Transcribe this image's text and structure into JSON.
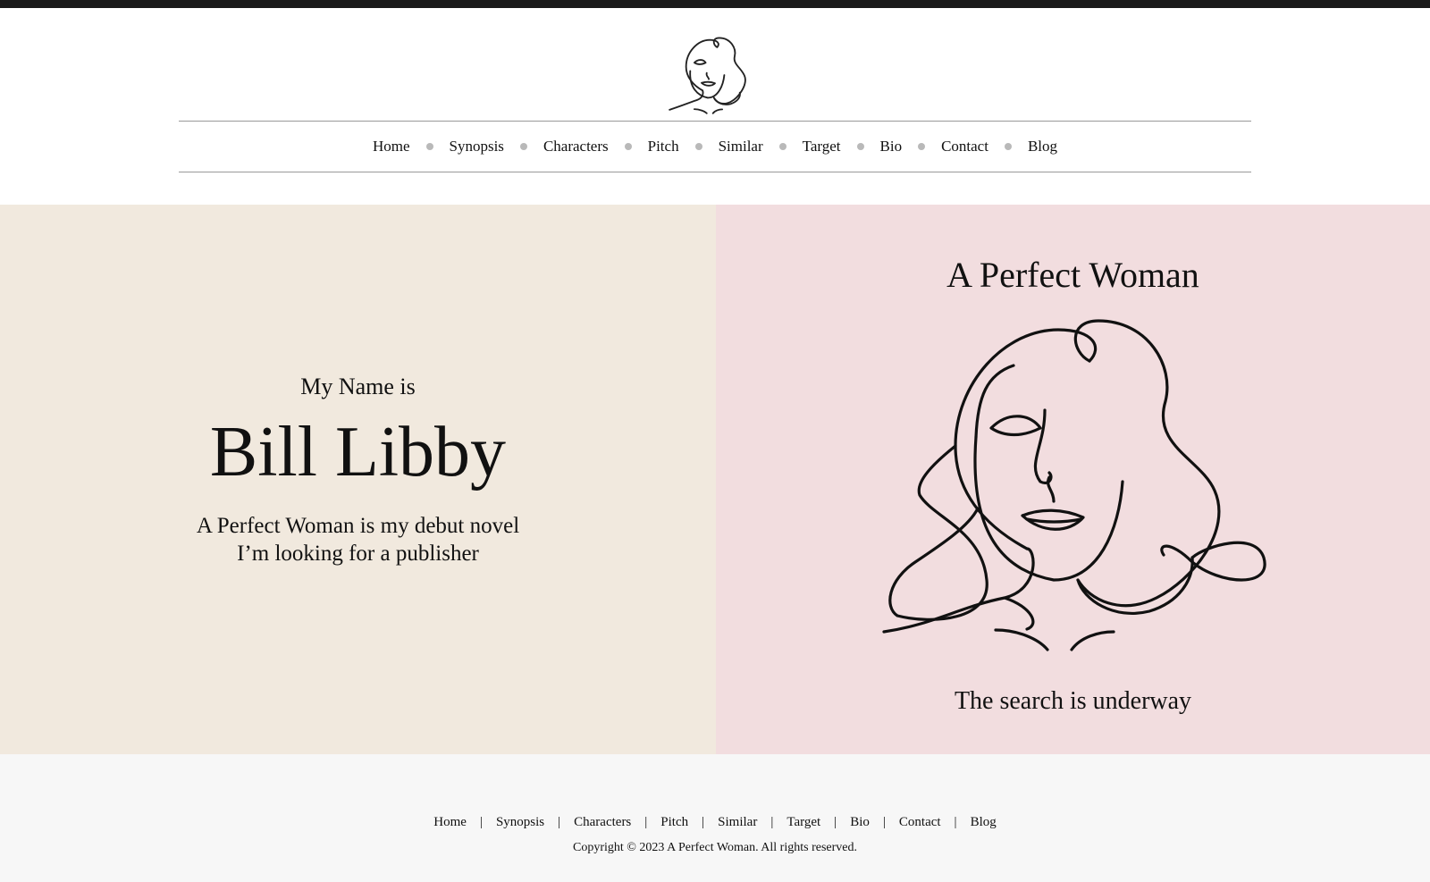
{
  "nav": {
    "items": [
      "Home",
      "Synopsis",
      "Characters",
      "Pitch",
      "Similar",
      "Target",
      "Bio",
      "Contact",
      "Blog"
    ]
  },
  "hero": {
    "intro": "My Name is",
    "name": "Bill Libby",
    "tagline_1": "A Perfect Woman is my debut novel",
    "tagline_2": "I’m looking for a publisher",
    "book_title": "A Perfect Woman",
    "subtitle": "The search is underway"
  },
  "footer": {
    "items": [
      "Home",
      "Synopsis",
      "Characters",
      "Pitch",
      "Similar",
      "Target",
      "Bio",
      "Contact",
      "Blog"
    ],
    "separator": "|",
    "copyright": "Copyright © 2023 A Perfect Woman. All rights reserved."
  },
  "colors": {
    "left_panel_bg": "#f1e9de",
    "right_panel_bg": "#f2dddf",
    "footer_bg": "#f7f7f7",
    "top_bar": "#1a1a1a",
    "nav_dot": "#b9b9b9"
  },
  "icons": {
    "logo": "woman-face-line-art-icon",
    "illustration": "woman-face-line-art"
  }
}
